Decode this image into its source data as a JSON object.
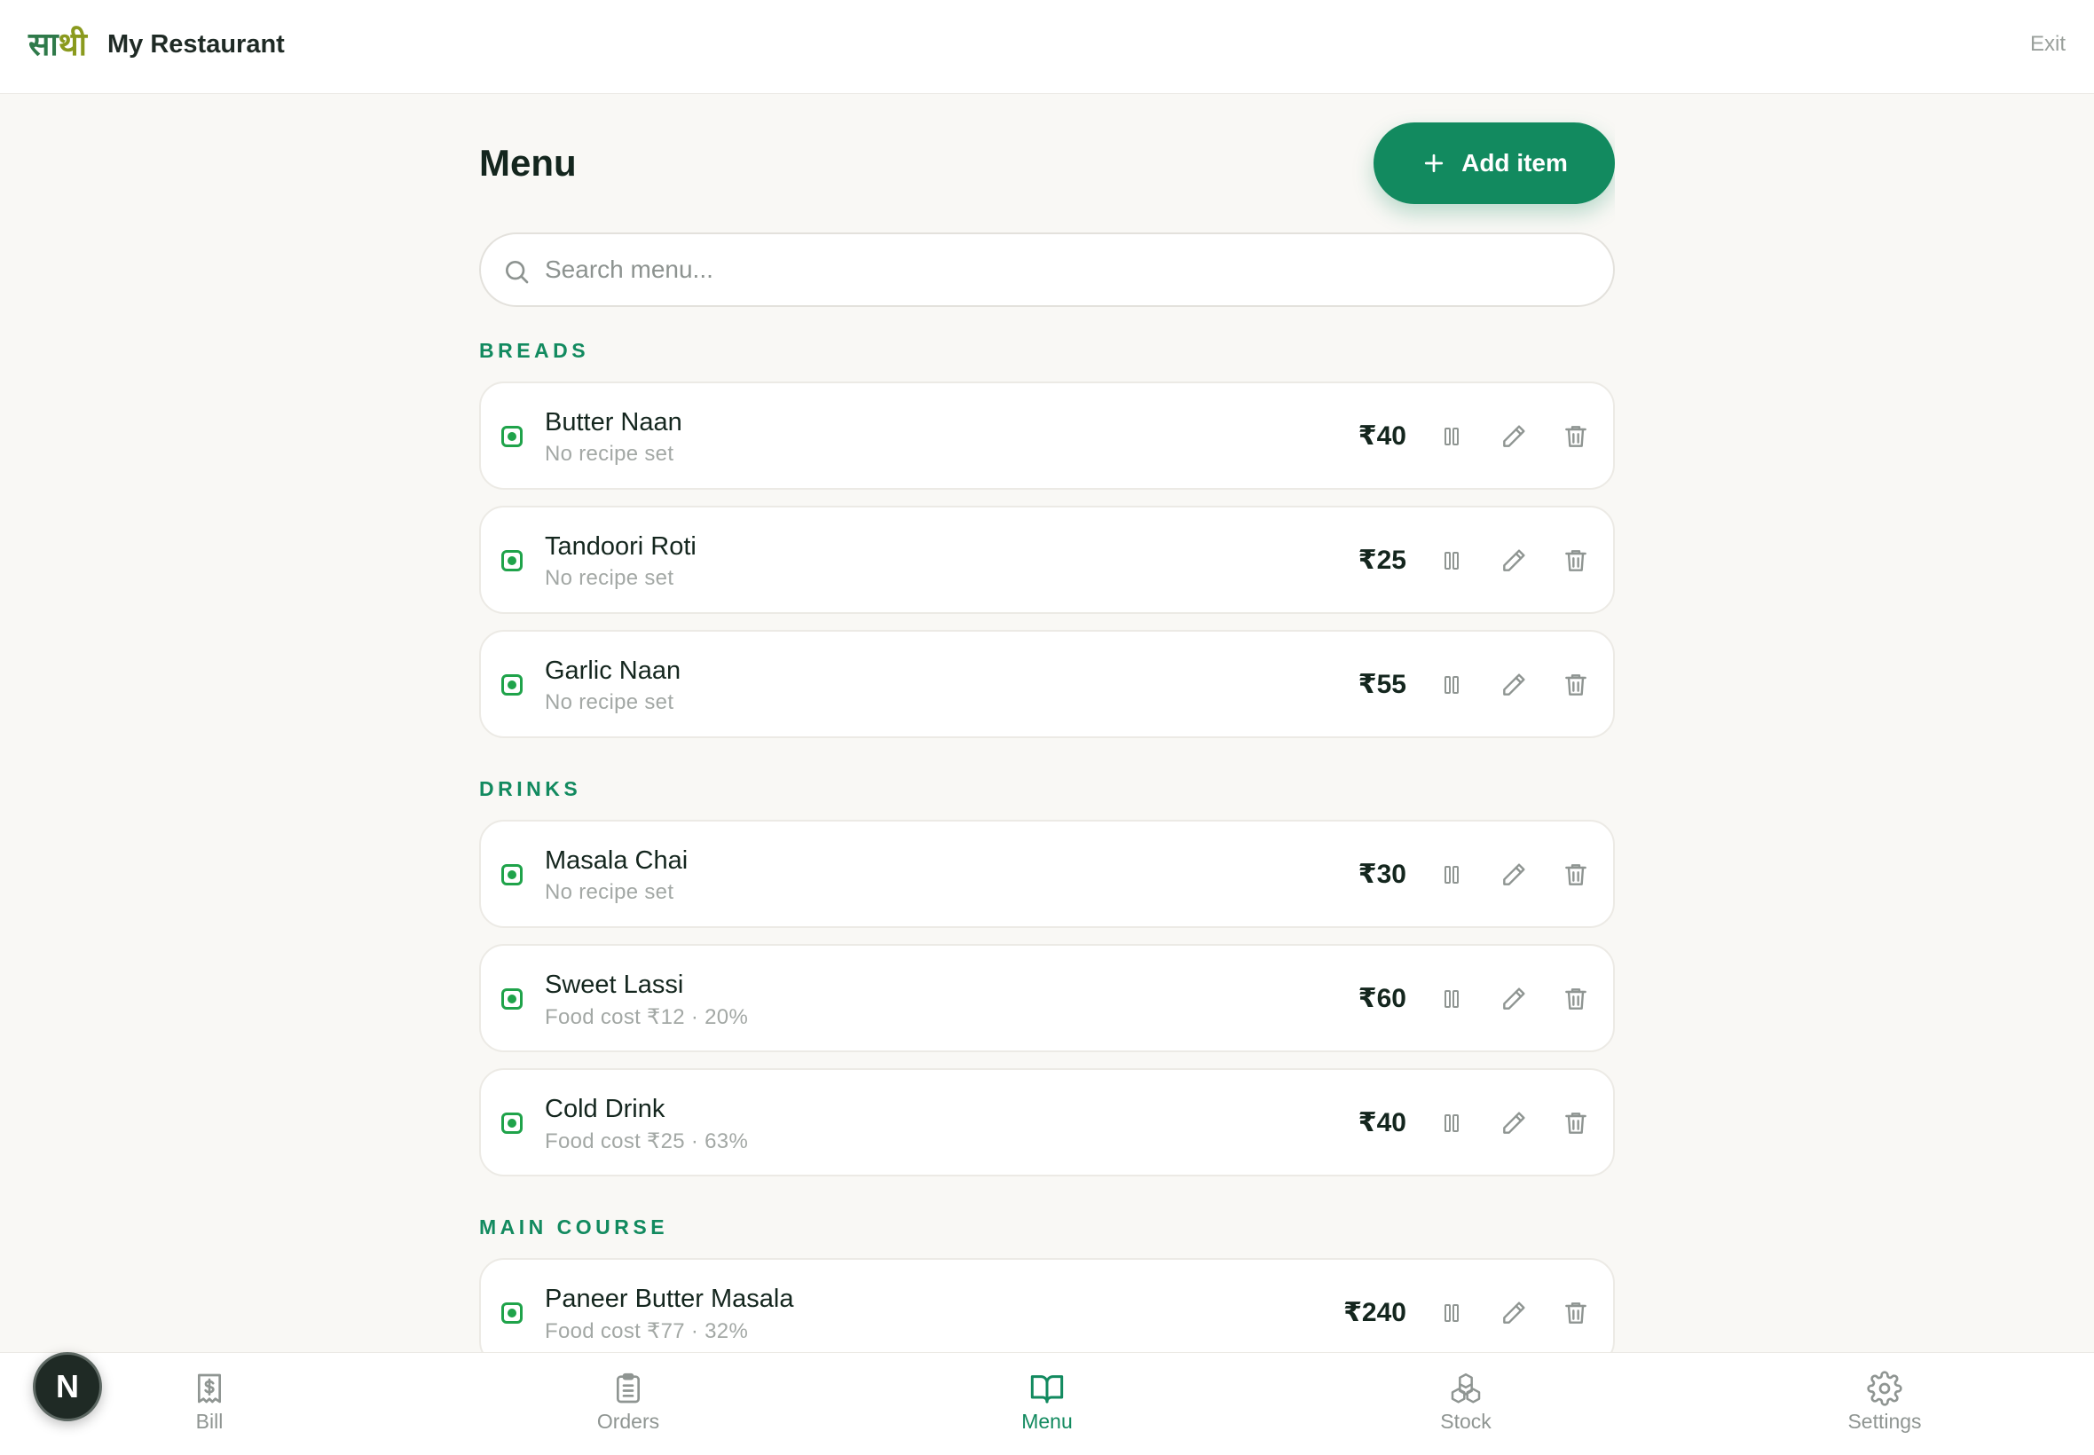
{
  "app": {
    "logo_part1": "सा",
    "logo_part2": "थी",
    "restaurant_name": "My Restaurant",
    "exit_label": "Exit"
  },
  "page": {
    "title": "Menu",
    "add_button_label": "Add item",
    "search_placeholder": "Search menu..."
  },
  "categories": [
    {
      "label": "BREADS",
      "items": [
        {
          "name": "Butter Naan",
          "sub": "No recipe set",
          "price": "₹40",
          "available": true
        },
        {
          "name": "Tandoori Roti",
          "sub": "No recipe set",
          "price": "₹25",
          "available": true
        },
        {
          "name": "Garlic Naan",
          "sub": "No recipe set",
          "price": "₹55",
          "available": true
        }
      ]
    },
    {
      "label": "DRINKS",
      "items": [
        {
          "name": "Masala Chai",
          "sub": "No recipe set",
          "price": "₹30",
          "available": true
        },
        {
          "name": "Sweet Lassi",
          "sub": "Food cost ₹12 · 20%",
          "price": "₹60",
          "available": true
        },
        {
          "name": "Cold Drink",
          "sub": "Food cost ₹25 · 63%",
          "price": "₹40",
          "available": true
        }
      ]
    },
    {
      "label": "MAIN COURSE",
      "items": [
        {
          "name": "Paneer Butter Masala",
          "sub": "Food cost ₹77 · 32%",
          "price": "₹240",
          "available": true
        }
      ]
    }
  ],
  "bottom_nav": {
    "tabs": [
      {
        "label": "Bill",
        "icon": "receipt-icon",
        "active": false
      },
      {
        "label": "Orders",
        "icon": "clipboard-icon",
        "active": false
      },
      {
        "label": "Menu",
        "icon": "book-open-icon",
        "active": true
      },
      {
        "label": "Stock",
        "icon": "boxes-icon",
        "active": false
      },
      {
        "label": "Settings",
        "icon": "gear-icon",
        "active": false
      }
    ]
  },
  "user": {
    "avatar_initial": "N"
  },
  "colors": {
    "accent": "#128a5f",
    "veg_indicator": "#1fa34a",
    "background": "#f9f8f5",
    "text": "#14261e",
    "muted": "#a3a8a5"
  }
}
